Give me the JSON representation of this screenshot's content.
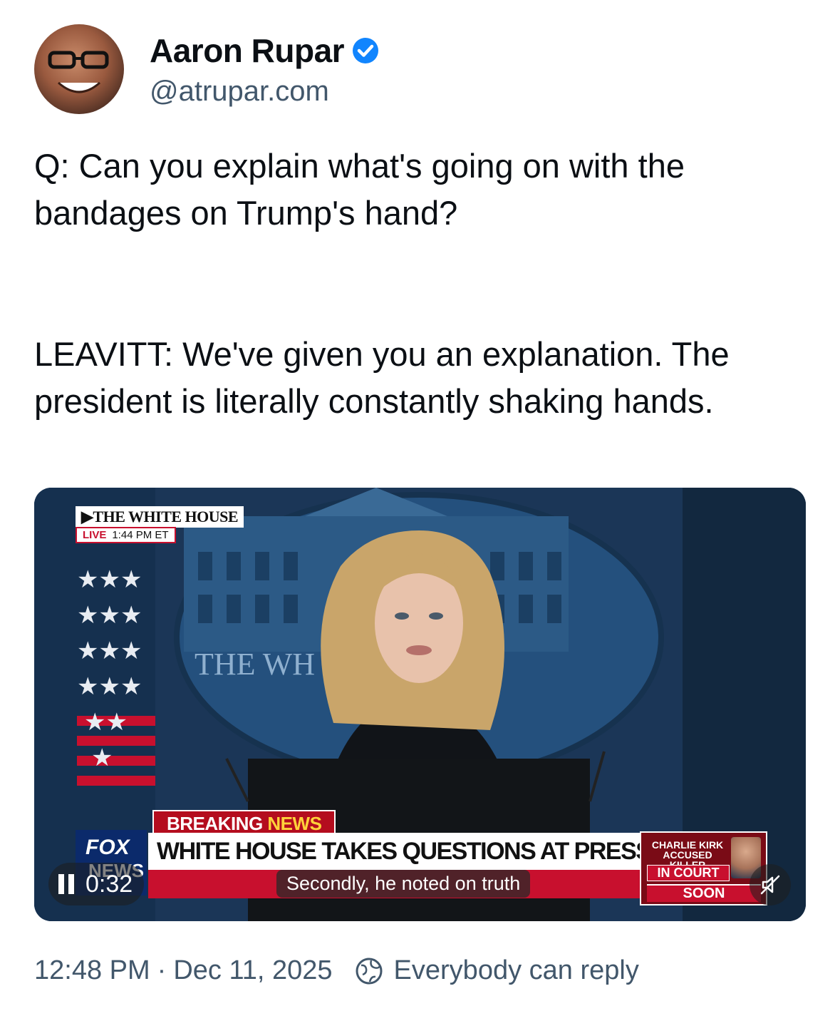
{
  "author": {
    "name": "Aaron Rupar",
    "handle": "@atrupar.com",
    "verified": true
  },
  "post": {
    "paragraph1": "Q: Can you explain what's going on with the bandages on Trump's hand?",
    "paragraph2": "LEAVITT: We've given you an explanation. The president is literally constantly shaking hands."
  },
  "video": {
    "network_bug": "▶THE WHITE HOUSE",
    "live_label": "LIVE",
    "live_time": "1:44 PM ET",
    "breaking_label": "BREAKING",
    "breaking_news": "NEWS",
    "chyron": "WHITE HOUSE TAKES QUESTIONS AT PRESS BRIEFING",
    "logo_line1": "FOX",
    "logo_line2": "NEWS",
    "promo_line1": "CHARLIE KIRK ACCUSED KILLER",
    "promo_line2": "IN COURT",
    "promo_line3": "SOON",
    "backdrop_text": "THE WH        USE",
    "elapsed": "0:32",
    "caption": "Secondly, he noted on truth",
    "muted": true
  },
  "footer": {
    "time": "12:48 PM",
    "separator": "·",
    "date": "Dec 11, 2025",
    "reply_setting": "Everybody can reply"
  },
  "colors": {
    "text_primary": "#0b0f14",
    "text_secondary": "#42576b",
    "verified_blue": "#1185fe",
    "fox_red": "#c8102e",
    "fox_blue": "#0b2a6b"
  }
}
